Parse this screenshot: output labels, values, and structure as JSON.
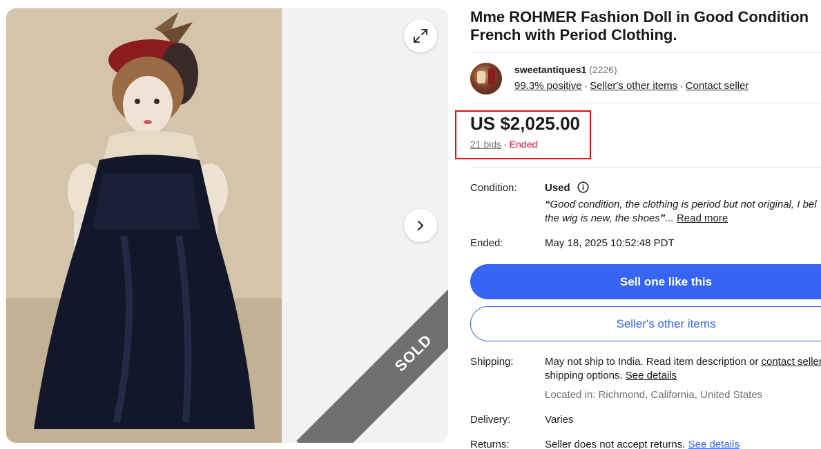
{
  "gallery": {
    "sold_label": "SOLD",
    "expand_icon": "expand-arrows-icon",
    "next_icon": "chevron-right-icon"
  },
  "listing": {
    "title": "Mme ROHMER Fashion Doll in Good Condition French with Period Clothing."
  },
  "seller": {
    "name": "sweetantiques1",
    "feedback_count": "(2226)",
    "positive": "99.3% positive",
    "other_items": "Seller's other items",
    "contact": "Contact seller"
  },
  "price": {
    "amount": "US $2,025.00",
    "bids": "21 bids",
    "status": "Ended",
    "highlight_color": "#e30e0e"
  },
  "condition": {
    "label": "Condition:",
    "value": "Used",
    "quote_line1": "Good condition, the clothing is period but not original, I bel",
    "quote_line2": "the wig is new, the shoes",
    "ellipsis": "...",
    "read_more": "Read more"
  },
  "ended": {
    "label": "Ended:",
    "value": "May 18, 2025 10:52:48 PDT"
  },
  "actions": {
    "sell_one": "Sell one like this",
    "seller_items": "Seller's other items",
    "primary_color": "#3665f3"
  },
  "shipping": {
    "label": "Shipping:",
    "line1": "May not ship to India. Read item description or",
    "contact_link": "contact seller",
    "line2": "shipping options.",
    "see_details": "See details",
    "located": "Located in: Richmond, California, United States"
  },
  "delivery": {
    "label": "Delivery:",
    "value": "Varies"
  },
  "returns": {
    "label": "Returns:",
    "value": "Seller does not accept returns.",
    "see_details": "See details"
  }
}
